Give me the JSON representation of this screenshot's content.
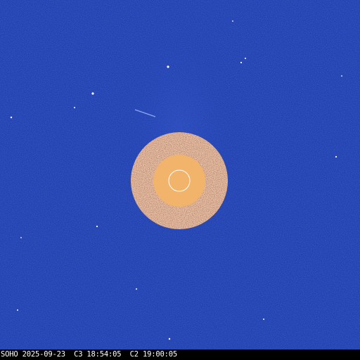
{
  "image": {
    "caption": "SOHO 2025-09-23  C3 18:54:05  C2 19:00:05"
  },
  "colors": {
    "sky": "#1f3fb0",
    "sky_dark": "#0f2a8a",
    "sky_light": "#3a5cd0",
    "occulter_ring": "#6b3a1e",
    "occulter_disk": "#f2b36b",
    "sun_outline": "#ffffff",
    "star": "#ffffff",
    "caption_text": "#ffffff",
    "caption_bg": "#000000"
  },
  "icons": {
    "occulter": "occulter-disk-icon",
    "sun": "sun-outline-icon"
  }
}
